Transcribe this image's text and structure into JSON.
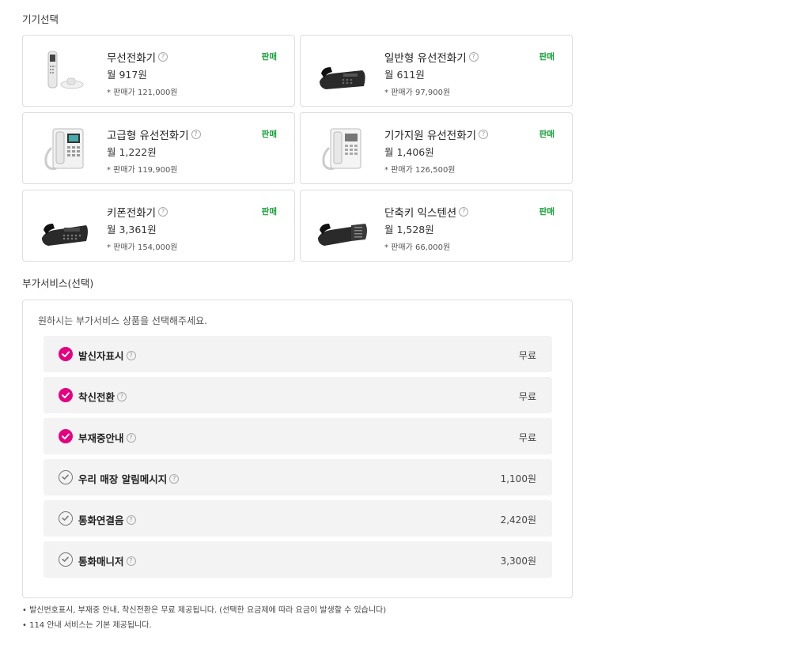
{
  "device_section": {
    "title": "기기선택",
    "help_glyph": "?",
    "devices": [
      {
        "name": "무선전화기",
        "monthly": "월 917원",
        "sale_price": "* 판매가 121,000원",
        "tag": "판매",
        "icon": "cordless-phone-icon"
      },
      {
        "name": "일반형 유선전화기",
        "monthly": "월 611원",
        "sale_price": "* 판매가 97,900원",
        "tag": "판매",
        "icon": "desk-phone-black-icon"
      },
      {
        "name": "고급형 유선전화기",
        "monthly": "월 1,222원",
        "sale_price": "* 판매가 119,900원",
        "tag": "판매",
        "icon": "desk-phone-white-icon"
      },
      {
        "name": "기가지원 유선전화기",
        "monthly": "월 1,406원",
        "sale_price": "* 판매가 126,500원",
        "tag": "판매",
        "icon": "desk-phone-white-icon"
      },
      {
        "name": "키폰전화기",
        "monthly": "월 3,361원",
        "sale_price": "* 판매가 154,000원",
        "tag": "판매",
        "icon": "keyphone-icon"
      },
      {
        "name": "단축키 익스텐션",
        "monthly": "월 1,528원",
        "sale_price": "* 판매가 66,000원",
        "tag": "판매",
        "icon": "extension-module-icon"
      }
    ]
  },
  "addon_section": {
    "title": "부가서비스(선택)",
    "guide": "원하시는 부가서비스 상품을 선택해주세요.",
    "items": [
      {
        "name": "발신자표시",
        "price": "무료",
        "checked": true
      },
      {
        "name": "착신전환",
        "price": "무료",
        "checked": true
      },
      {
        "name": "부재중안내",
        "price": "무료",
        "checked": true
      },
      {
        "name": "우리 매장 알림메시지",
        "price": "1,100원",
        "checked": false
      },
      {
        "name": "통화연결음",
        "price": "2,420원",
        "checked": false
      },
      {
        "name": "통화매니저",
        "price": "3,300원",
        "checked": false
      }
    ]
  },
  "notes": [
    "발신번호표시, 부재중 안내, 착신전환은 무료 제공됩니다. (선택한 요금제에 따라 요금이 발생할 수 있습니다)",
    "114 안내 서비스는 기본 제공됩니다."
  ],
  "colors": {
    "check_on": "#e4007f",
    "sale_tag": "#17a03a"
  }
}
